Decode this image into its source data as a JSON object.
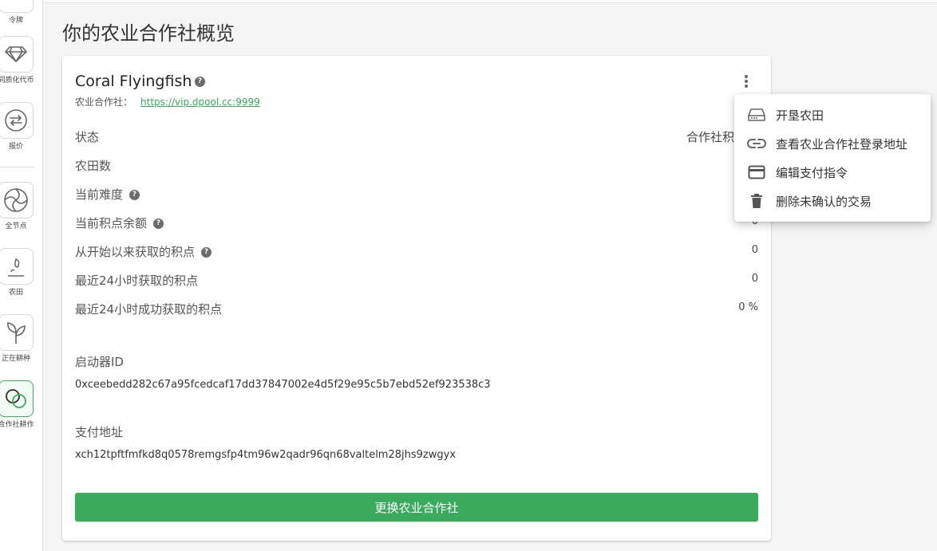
{
  "sidebar": {
    "items": [
      {
        "label": "令牌",
        "icon": "token-icon"
      },
      {
        "label": "同质化代币",
        "icon": "diamond-icon"
      },
      {
        "label": "报价",
        "icon": "swap-icon"
      },
      {
        "label": "全节点",
        "icon": "aperture-icon"
      },
      {
        "label": "农田",
        "icon": "seed-icon"
      },
      {
        "label": "正在耕种",
        "icon": "sprout-icon"
      },
      {
        "label": "合作社耕作",
        "icon": "link-rings-icon"
      }
    ]
  },
  "page": {
    "title": "你的农业合作社概览"
  },
  "card": {
    "name": "Coral Flyingfish",
    "pool_label": "农业合作社：",
    "pool_url": "https://vip.dpool.cc:9999",
    "stats": [
      {
        "label": "状态",
        "value": "合作社积",
        "help": false
      },
      {
        "label": "农田数",
        "value": "",
        "help": false
      },
      {
        "label": "当前难度",
        "value": "",
        "help": true
      },
      {
        "label": "当前积点余额",
        "value": "0",
        "help": true
      },
      {
        "label": "从开始以来获取的积点",
        "value": "0",
        "help": true
      },
      {
        "label": "最近24小时获取的积点",
        "value": "0",
        "help": false
      },
      {
        "label": "最近24小时成功获取的积点",
        "value": "0 %",
        "help": false
      }
    ],
    "launcher_label": "启动器ID",
    "launcher_id": "0xceebedd282c67a95fcedcaf17dd37847002e4d5f29e95c5b7ebd52ef923538c3",
    "payout_label": "支付地址",
    "payout_address": "xch12tpftfmfkd8q0578remgsfp4tm96w2qadr96qn68valtelm28jhs9zwgyx",
    "change_button": "更换农业合作社"
  },
  "menu": {
    "items": [
      {
        "label": "开垦农田",
        "icon": "hard-drive-icon"
      },
      {
        "label": "查看农业合作社登录地址",
        "icon": "link-icon"
      },
      {
        "label": "编辑支付指令",
        "icon": "credit-card-icon"
      },
      {
        "label": "删除未确认的交易",
        "icon": "trash-icon"
      }
    ]
  },
  "colors": {
    "accent": "#3aaa5c",
    "icon_gray": "#666666"
  }
}
